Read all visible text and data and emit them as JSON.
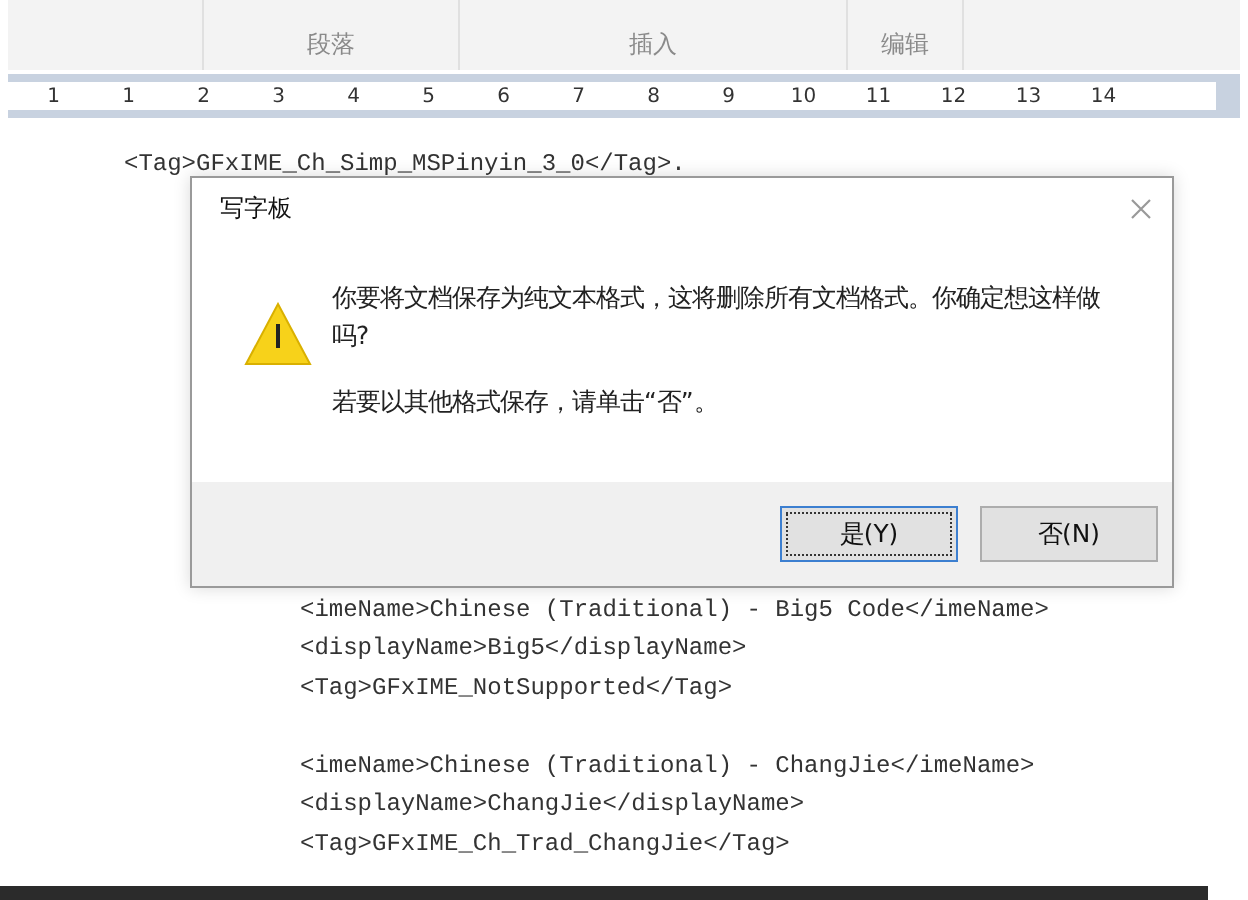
{
  "ribbon": {
    "groups": [
      {
        "label": "段落"
      },
      {
        "label": "插入"
      },
      {
        "label": "编辑"
      }
    ]
  },
  "ruler": {
    "labels": [
      "1",
      "1",
      "2",
      "3",
      "4",
      "5",
      "6",
      "7",
      "8",
      "9",
      "10",
      "11",
      "12",
      "13",
      "14"
    ]
  },
  "document": {
    "lines_above": [
      "<Tag>GFxIME_Ch_Simp_MSPinyin_3_0</Tag>."
    ],
    "blocks_below": [
      [
        "<imeName>Chinese (Traditional) - Big5 Code</imeName>",
        "<displayName>Big5</displayName>",
        "<Tag>GFxIME_NotSupported</Tag>"
      ],
      [
        "<imeName>Chinese (Traditional) - ChangJie</imeName>",
        "<displayName>ChangJie</displayName>",
        "<Tag>GFxIME_Ch_Trad_ChangJie</Tag>"
      ]
    ]
  },
  "dialog": {
    "title": "写字板",
    "message": "你要将文档保存为纯文本格式，这将删除所有文档格式。你确定想这样做吗?",
    "hint": "若要以其他格式保存，请单击“否”。",
    "buttons": [
      {
        "label": "是(Y)",
        "selected": true
      },
      {
        "label": "否(N)",
        "selected": false
      }
    ]
  }
}
